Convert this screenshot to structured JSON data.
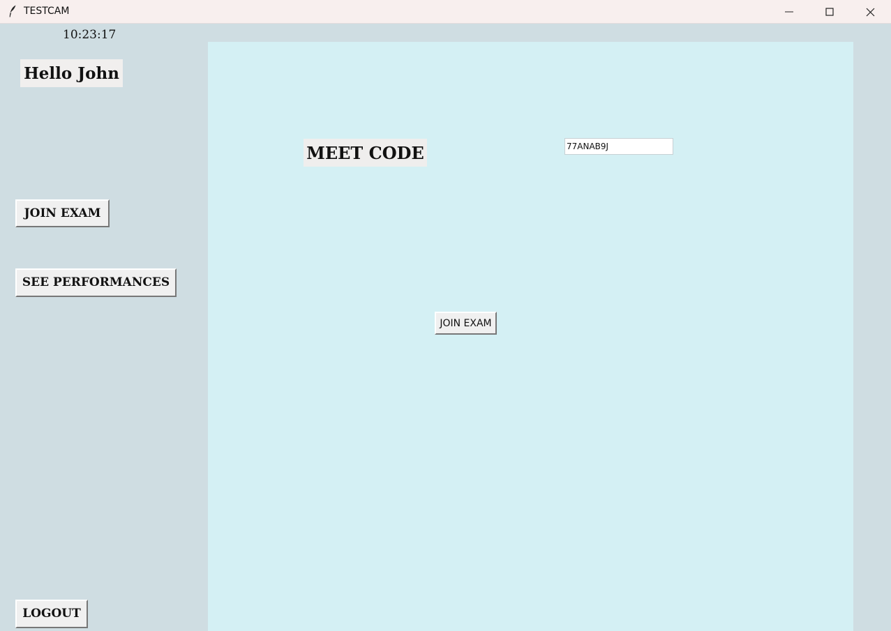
{
  "window": {
    "title": "TESTCAM",
    "icon": "feather-icon",
    "controls": {
      "minimize_icon": "minimize-icon",
      "maximize_icon": "maximize-icon",
      "close_icon": "close-icon"
    }
  },
  "sidebar": {
    "clock": "10:23:17",
    "greeting": "Hello John",
    "buttons": {
      "join_exam": "JOIN EXAM",
      "see_performances": "SEE PERFORMANCES",
      "logout": "LOGOUT"
    }
  },
  "main": {
    "meet_code_label": "MEET CODE",
    "meet_code_value": "77ANAB9J",
    "join_exam_button": "JOIN EXAM"
  },
  "colors": {
    "window_bg": "#cfdde2",
    "panel_bg": "#d4f0f4",
    "titlebar_bg": "#f8efee"
  }
}
